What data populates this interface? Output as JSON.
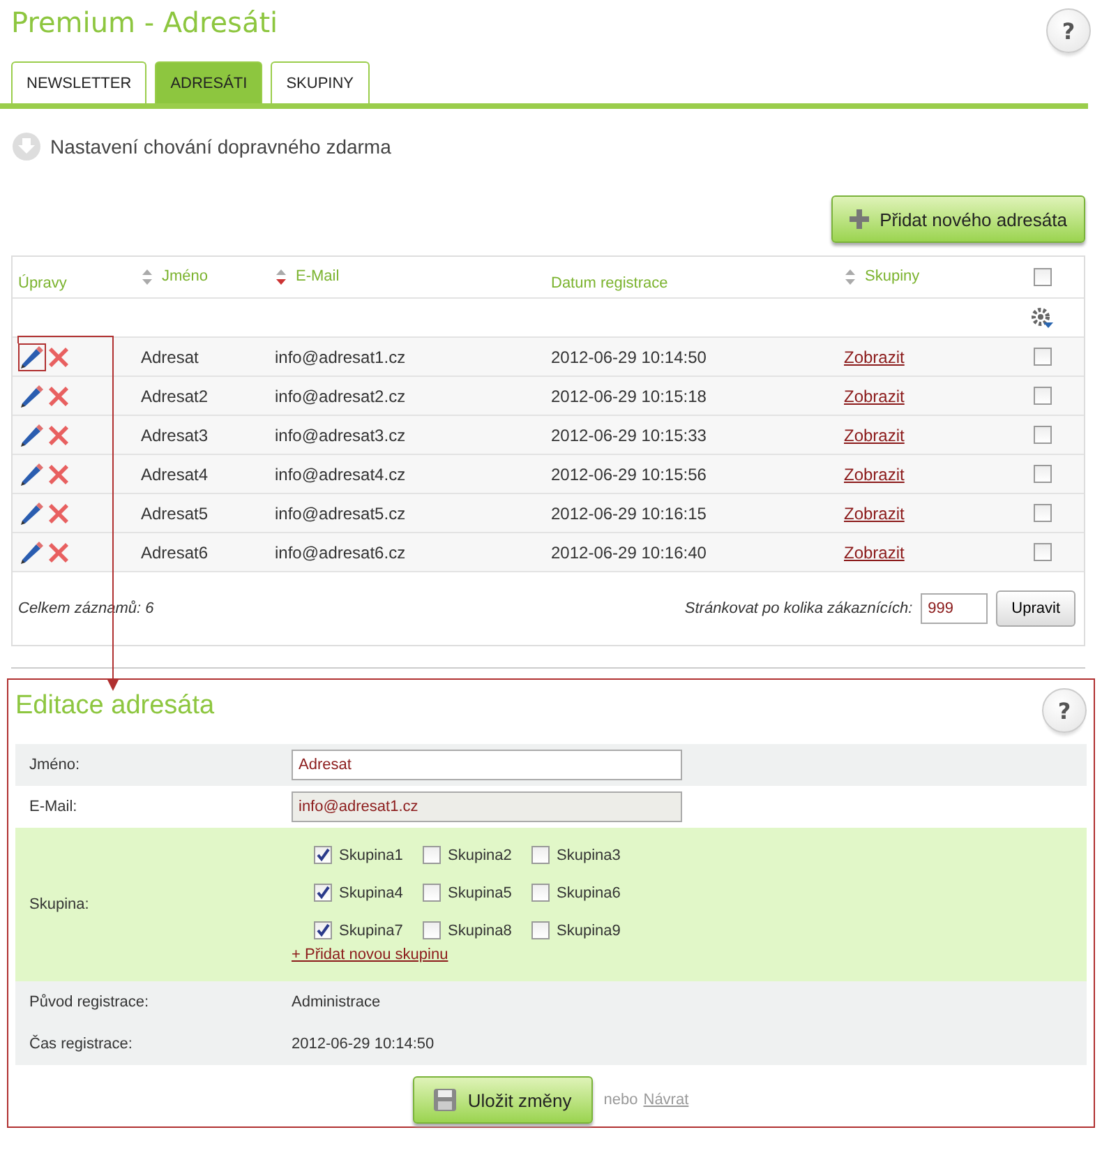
{
  "page": {
    "title": "Premium - Adresáti",
    "help": "?"
  },
  "tabs": [
    {
      "label": "NEWSLETTER",
      "selected": false
    },
    {
      "label": "ADRESÁTI",
      "selected": true
    },
    {
      "label": "SKUPINY",
      "selected": false
    }
  ],
  "section_link": "Nastavení chování dopravného zdarma",
  "add_button": "Přidat nového adresáta",
  "table": {
    "columns": [
      {
        "label": "Úpravy",
        "kind": "plain"
      },
      {
        "label": "Jméno",
        "kind": "sortable"
      },
      {
        "label": "E-Mail",
        "kind": "descending"
      },
      {
        "label": "Datum registrace",
        "kind": "plain"
      },
      {
        "label": "Skupiny",
        "kind": "sortable"
      }
    ],
    "select_all": false,
    "rows": [
      {
        "name": "Adresat",
        "email": "info@adresat1.cz",
        "date": "2012-06-29 10:14:50",
        "groups_link": "Zobrazit",
        "checked": false,
        "selected": true
      },
      {
        "name": "Adresat2",
        "email": "info@adresat2.cz",
        "date": "2012-06-29 10:15:18",
        "groups_link": "Zobrazit",
        "checked": false,
        "selected": false
      },
      {
        "name": "Adresat3",
        "email": "info@adresat3.cz",
        "date": "2012-06-29 10:15:33",
        "groups_link": "Zobrazit",
        "checked": false,
        "selected": false
      },
      {
        "name": "Adresat4",
        "email": "info@adresat4.cz",
        "date": "2012-06-29 10:15:56",
        "groups_link": "Zobrazit",
        "checked": false,
        "selected": false
      },
      {
        "name": "Adresat5",
        "email": "info@adresat5.cz",
        "date": "2012-06-29 10:16:15",
        "groups_link": "Zobrazit",
        "checked": false,
        "selected": false
      },
      {
        "name": "Adresat6",
        "email": "info@adresat6.cz",
        "date": "2012-06-29 10:16:40",
        "groups_link": "Zobrazit",
        "checked": false,
        "selected": false
      }
    ],
    "total": "Celkem záznamů: 6",
    "paging_label": "Stránkovat po kolika zákaznících:",
    "paging_value": "999",
    "paging_button": "Upravit"
  },
  "editor": {
    "title": "Editace adresáta",
    "help": "?",
    "name_label": "Jméno:",
    "name_value": "Adresat",
    "email_label": "E-Mail:",
    "email_value": "info@adresat1.cz",
    "groups_label": "Skupina:",
    "groups": [
      {
        "label": "Skupina1",
        "checked": true
      },
      {
        "label": "Skupina2",
        "checked": false
      },
      {
        "label": "Skupina3",
        "checked": false
      },
      {
        "label": "Skupina4",
        "checked": true
      },
      {
        "label": "Skupina5",
        "checked": false
      },
      {
        "label": "Skupina6",
        "checked": false
      },
      {
        "label": "Skupina7",
        "checked": true
      },
      {
        "label": "Skupina8",
        "checked": false
      },
      {
        "label": "Skupina9",
        "checked": false
      }
    ],
    "add_group": "+ Přidat novou skupinu",
    "origin_label": "Původ registrace:",
    "origin_value": "Administrace",
    "time_label": "Čas registrace:",
    "time_value": "2012-06-29 10:14:50",
    "save_button": "Uložit změny",
    "or_text": "nebo",
    "back_link": "Návrat"
  }
}
